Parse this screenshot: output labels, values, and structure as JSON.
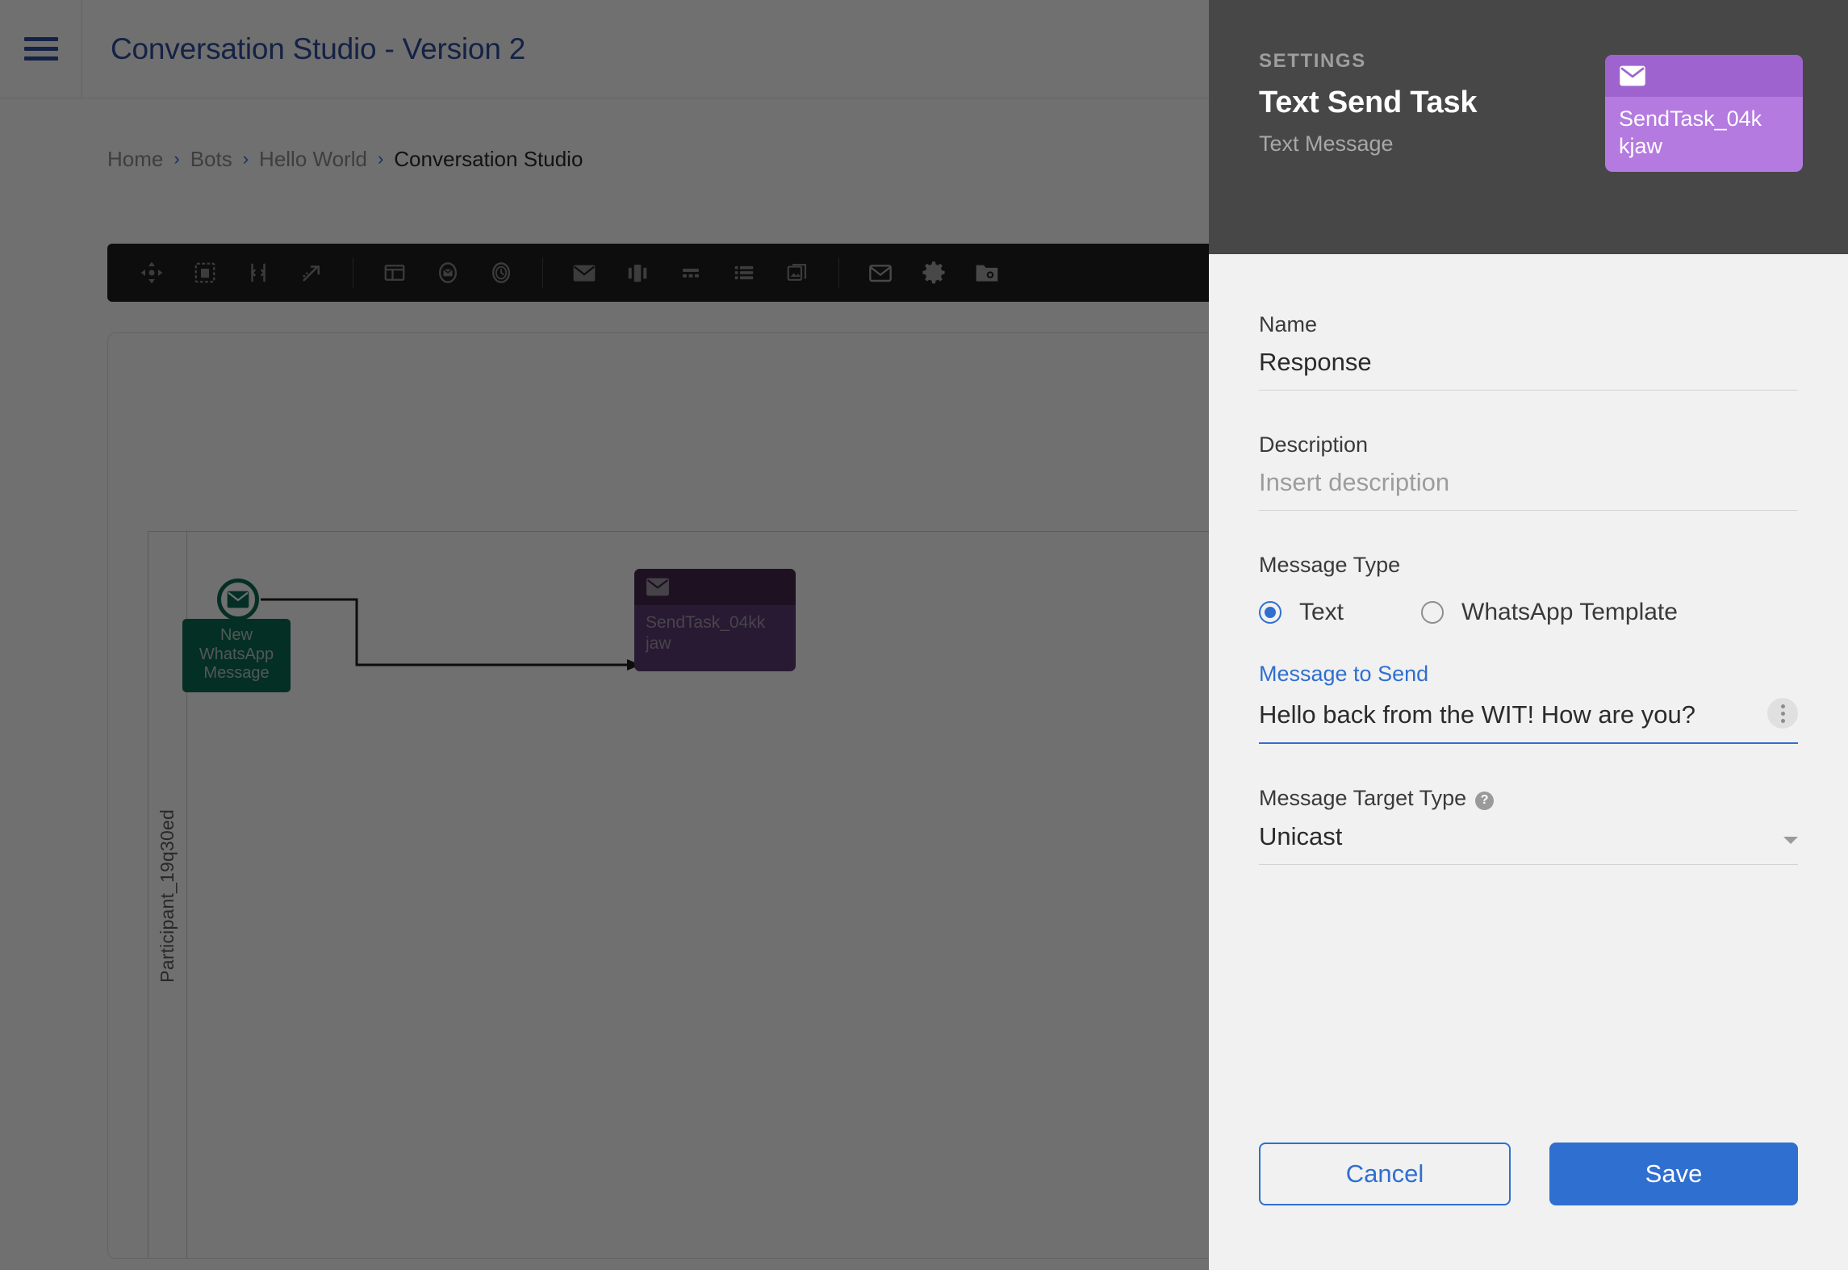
{
  "header": {
    "menu_icon": "hamburger-icon",
    "title": "Conversation Studio - Version 2"
  },
  "breadcrumb": {
    "separator": "›",
    "items": [
      {
        "label": "Home",
        "current": false
      },
      {
        "label": "Bots",
        "current": false
      },
      {
        "label": "Hello World",
        "current": false
      },
      {
        "label": "Conversation Studio",
        "current": true
      }
    ]
  },
  "toolbar": {
    "items": [
      {
        "icon": "move-tool-icon"
      },
      {
        "icon": "marquee-select-icon"
      },
      {
        "icon": "align-distribute-icon"
      },
      {
        "icon": "connect-arrow-icon"
      },
      {
        "icon": "sep"
      },
      {
        "icon": "lane-layout-icon"
      },
      {
        "icon": "message-start-event-icon"
      },
      {
        "icon": "timer-event-icon"
      },
      {
        "icon": "sep"
      },
      {
        "icon": "envelope-task-icon"
      },
      {
        "icon": "carousel-icon"
      },
      {
        "icon": "quick-reply-icon"
      },
      {
        "icon": "list-message-icon"
      },
      {
        "icon": "media-gallery-icon"
      },
      {
        "icon": "sep"
      },
      {
        "icon": "mail-icon"
      },
      {
        "icon": "gear-icon"
      },
      {
        "icon": "folder-config-icon"
      }
    ]
  },
  "canvas": {
    "pool_label": "Participant_19q30ed",
    "start_event": {
      "icon": "message-envelope-icon",
      "label": "New WhatsApp Message",
      "color": "#0b6b52"
    },
    "send_task": {
      "icon": "envelope-icon",
      "label": "SendTask_04kk jaw",
      "color": "#5c3b72",
      "header_color": "#44294f"
    }
  },
  "drawer": {
    "kicker": "SETTINGS",
    "title": "Text Send Task",
    "subtitle": "Text Message",
    "node_chip": {
      "icon": "envelope-icon",
      "label": "SendTask_04k kjaw",
      "color": "#b47ae0",
      "header_color": "#9f63cf"
    },
    "fields": {
      "name": {
        "label": "Name",
        "value": "Response"
      },
      "description": {
        "label": "Description",
        "value": "",
        "placeholder": "Insert description"
      },
      "message_type": {
        "label": "Message Type",
        "options": [
          {
            "label": "Text",
            "selected": true
          },
          {
            "label": "WhatsApp Template",
            "selected": false
          }
        ]
      },
      "message_to_send": {
        "label": "Message to Send",
        "value": "Hello back from the WIT! How are you?",
        "kebab_icon": "more-options-icon"
      },
      "message_target_type": {
        "label": "Message Target Type",
        "help_icon": "help-icon",
        "help_glyph": "?",
        "value": "Unicast",
        "chevron_icon": "chevron-down-icon"
      }
    },
    "footer": {
      "cancel_label": "Cancel",
      "save_label": "Save"
    }
  },
  "colors": {
    "accent_blue": "#2f6fd0",
    "brand_navy": "#2f4e9e",
    "overlay": "#666666",
    "drawer_header": "#474747",
    "drawer_bg": "#f1f1f1"
  }
}
